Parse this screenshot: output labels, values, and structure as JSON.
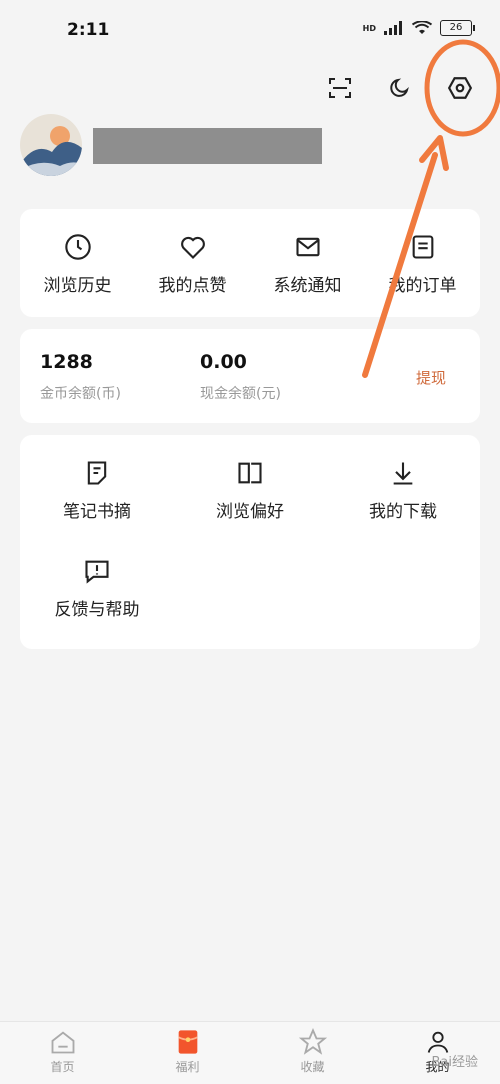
{
  "status_bar": {
    "time": "2:11",
    "network": "HD",
    "battery": "26"
  },
  "quick_links": [
    {
      "label": "浏览历史",
      "icon": "clock-icon"
    },
    {
      "label": "我的点赞",
      "icon": "heart-icon"
    },
    {
      "label": "系统通知",
      "icon": "mail-icon"
    },
    {
      "label": "我的订单",
      "icon": "order-icon"
    }
  ],
  "wallet": {
    "coins_value": "1288",
    "coins_label": "金币余额(币)",
    "cash_value": "0.00",
    "cash_label": "现金余额(元)",
    "withdraw_label": "提现"
  },
  "tools": [
    {
      "label": "笔记书摘",
      "icon": "note-icon"
    },
    {
      "label": "浏览偏好",
      "icon": "book-icon"
    },
    {
      "label": "我的下载",
      "icon": "download-icon"
    },
    {
      "label": "反馈与帮助",
      "icon": "feedback-icon"
    }
  ],
  "tab_bar": [
    {
      "label": "首页",
      "icon": "home-icon"
    },
    {
      "label": "福利",
      "icon": "redpacket-icon"
    },
    {
      "label": "收藏",
      "icon": "star-icon"
    },
    {
      "label": "我的",
      "icon": "profile-icon"
    }
  ],
  "colors": {
    "accent": "#d06a3b",
    "annotation": "#f07a3e",
    "redacted": "#8e8e8e"
  },
  "watermark": "Bai经验"
}
